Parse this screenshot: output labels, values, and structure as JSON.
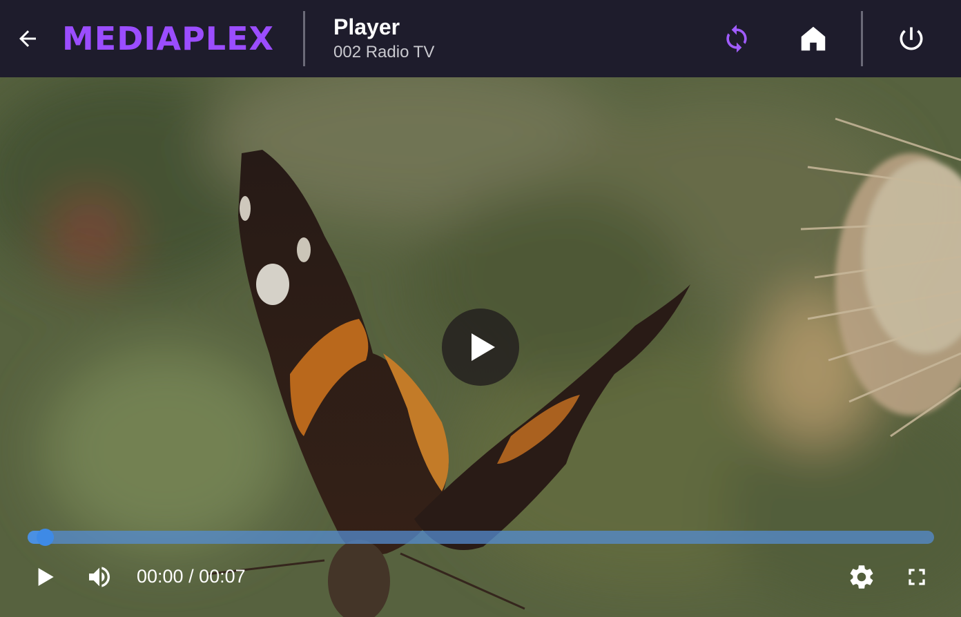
{
  "header": {
    "logo_text": "MEDIAPLEX",
    "title": "Player",
    "subtitle": "002 Radio TV",
    "icons": {
      "back": "arrow-left-icon",
      "sync": "sync-icon",
      "home": "home-icon",
      "power": "power-icon"
    }
  },
  "player": {
    "current_time": "00:00",
    "duration": "00:07",
    "time_display": "00:00 / 00:07",
    "progress": 0.02,
    "state": "paused",
    "icons": {
      "big_play": "play-icon",
      "play": "play-icon",
      "volume": "volume-icon",
      "settings": "settings-gear-icon",
      "fullscreen": "fullscreen-icon"
    }
  },
  "colors": {
    "header_bg": "#1e1c2c",
    "logo_purple": "#9b4dff",
    "logo_teal": "#3fd6a8",
    "sync_purple": "#a05cff",
    "progress_blue": "#4a90e2"
  }
}
